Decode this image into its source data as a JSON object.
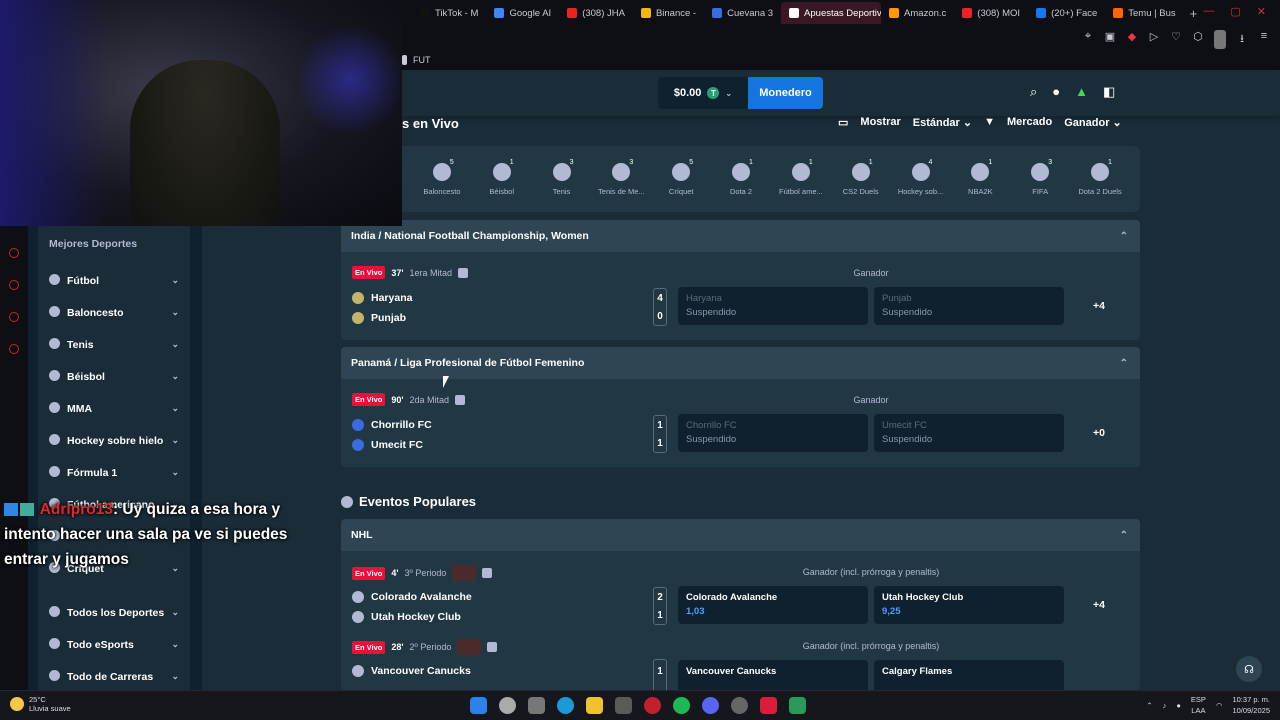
{
  "browser": {
    "tabs": [
      {
        "label": "TikTok - M",
        "color": "#111"
      },
      {
        "label": "Google AI",
        "color": "#4285f4"
      },
      {
        "label": "(308) JHA",
        "color": "#e22"
      },
      {
        "label": "Binance - ",
        "color": "#f0b90b"
      },
      {
        "label": "Cuevana 3",
        "color": "#3a6be0"
      },
      {
        "label": "Apuestas Deportiv",
        "color": "#fff",
        "active": true
      },
      {
        "label": "Amazon.c",
        "color": "#ff9900"
      },
      {
        "label": "(308) MOI",
        "color": "#e22"
      },
      {
        "label": "(20+) Face",
        "color": "#1877f2"
      },
      {
        "label": "Temu | Bus",
        "color": "#f60"
      }
    ],
    "add_tab": "+",
    "bookmark": "FUT"
  },
  "header": {
    "balance": "$0.00",
    "coin": "T",
    "wallet": "Monedero"
  },
  "page": {
    "title": "s en Vivo",
    "show_label": "Mostrar",
    "show_value": "Estándar",
    "market_label": "Mercado",
    "market_value": "Ganador"
  },
  "sports": [
    {
      "name": "Baloncesto",
      "count": "5"
    },
    {
      "name": "Béisbol",
      "count": "1"
    },
    {
      "name": "Tenis",
      "count": "3"
    },
    {
      "name": "Tenis de Me...",
      "count": "3"
    },
    {
      "name": "Críquet",
      "count": "5"
    },
    {
      "name": "Dota 2",
      "count": "1"
    },
    {
      "name": "Fútbol ame...",
      "count": "1"
    },
    {
      "name": "CS2 Duels",
      "count": "1"
    },
    {
      "name": "Hockey sob...",
      "count": "4"
    },
    {
      "name": "NBA2K",
      "count": "1"
    },
    {
      "name": "FIFA",
      "count": "3"
    },
    {
      "name": "Dota 2 Duels",
      "count": "1"
    }
  ],
  "sidebar": {
    "title": "Mejores Deportes",
    "items": [
      "Fútbol",
      "Baloncesto",
      "Tenis",
      "Béisbol",
      "MMA",
      "Hockey sobre hielo",
      "Fórmula 1",
      "Fútbol americano",
      "",
      "Críquet"
    ],
    "bottom": [
      "Todos los Deportes",
      "Todo eSports",
      "Todo de Carreras"
    ]
  },
  "chat": {
    "user": "Adripro13",
    "message": ": Uy quiza a esa hora y intento hacer una sala pa ve si puedes entrar y jugamos"
  },
  "matches": [
    {
      "league": "India / National Football Championship, Women",
      "live": "En Vivo",
      "minute": "37'",
      "period": "1era Mitad",
      "market": "Ganador",
      "home": "Haryana",
      "away": "Punjab",
      "home_score": "4",
      "away_score": "0",
      "odd1_name": "Haryana",
      "odd1_value": "Suspendido",
      "odd2_name": "Punjab",
      "odd2_value": "Suspendido",
      "more": "+4"
    },
    {
      "league": "Panamá / Liga Profesional de Fútbol Femenino",
      "live": "En Vivo",
      "minute": "90'",
      "period": "2da Mitad",
      "market": "Ganador",
      "home": "Chorrillo FC",
      "away": "Umecit FC",
      "home_score": "1",
      "away_score": "1",
      "odd1_name": "Chorrillo FC",
      "odd1_value": "Suspendido",
      "odd2_name": "Umecit FC",
      "odd2_value": "Suspendido",
      "more": "+0"
    }
  ],
  "popular": {
    "title": "Eventos Populares",
    "league": "NHL",
    "m1": {
      "live": "En Vivo",
      "minute": "4'",
      "period": "3º Periodo",
      "market": "Ganador (incl. prórroga y penaltis)",
      "home": "Colorado Avalanche",
      "away": "Utah Hockey Club",
      "home_score": "2",
      "away_score": "1",
      "odd1_name": "Colorado Avalanche",
      "odd1_value": "1,03",
      "odd2_name": "Utah Hockey Club",
      "odd2_value": "9,25",
      "more": "+4"
    },
    "m2": {
      "live": "En Vivo",
      "minute": "28'",
      "period": "2º Periodo",
      "market": "Ganador (incl. prórroga y penaltis)",
      "home": "Vancouver Canucks",
      "home_score": "1",
      "odd1_name": "Vancouver Canucks",
      "odd2_name": "Calgary Flames"
    }
  },
  "taskbar": {
    "temp": "25°C",
    "weather": "Lluvia suave",
    "lang1": "ESP",
    "lang2": "LAA",
    "time": "10:37 p. m.",
    "date": "10/09/2025"
  }
}
